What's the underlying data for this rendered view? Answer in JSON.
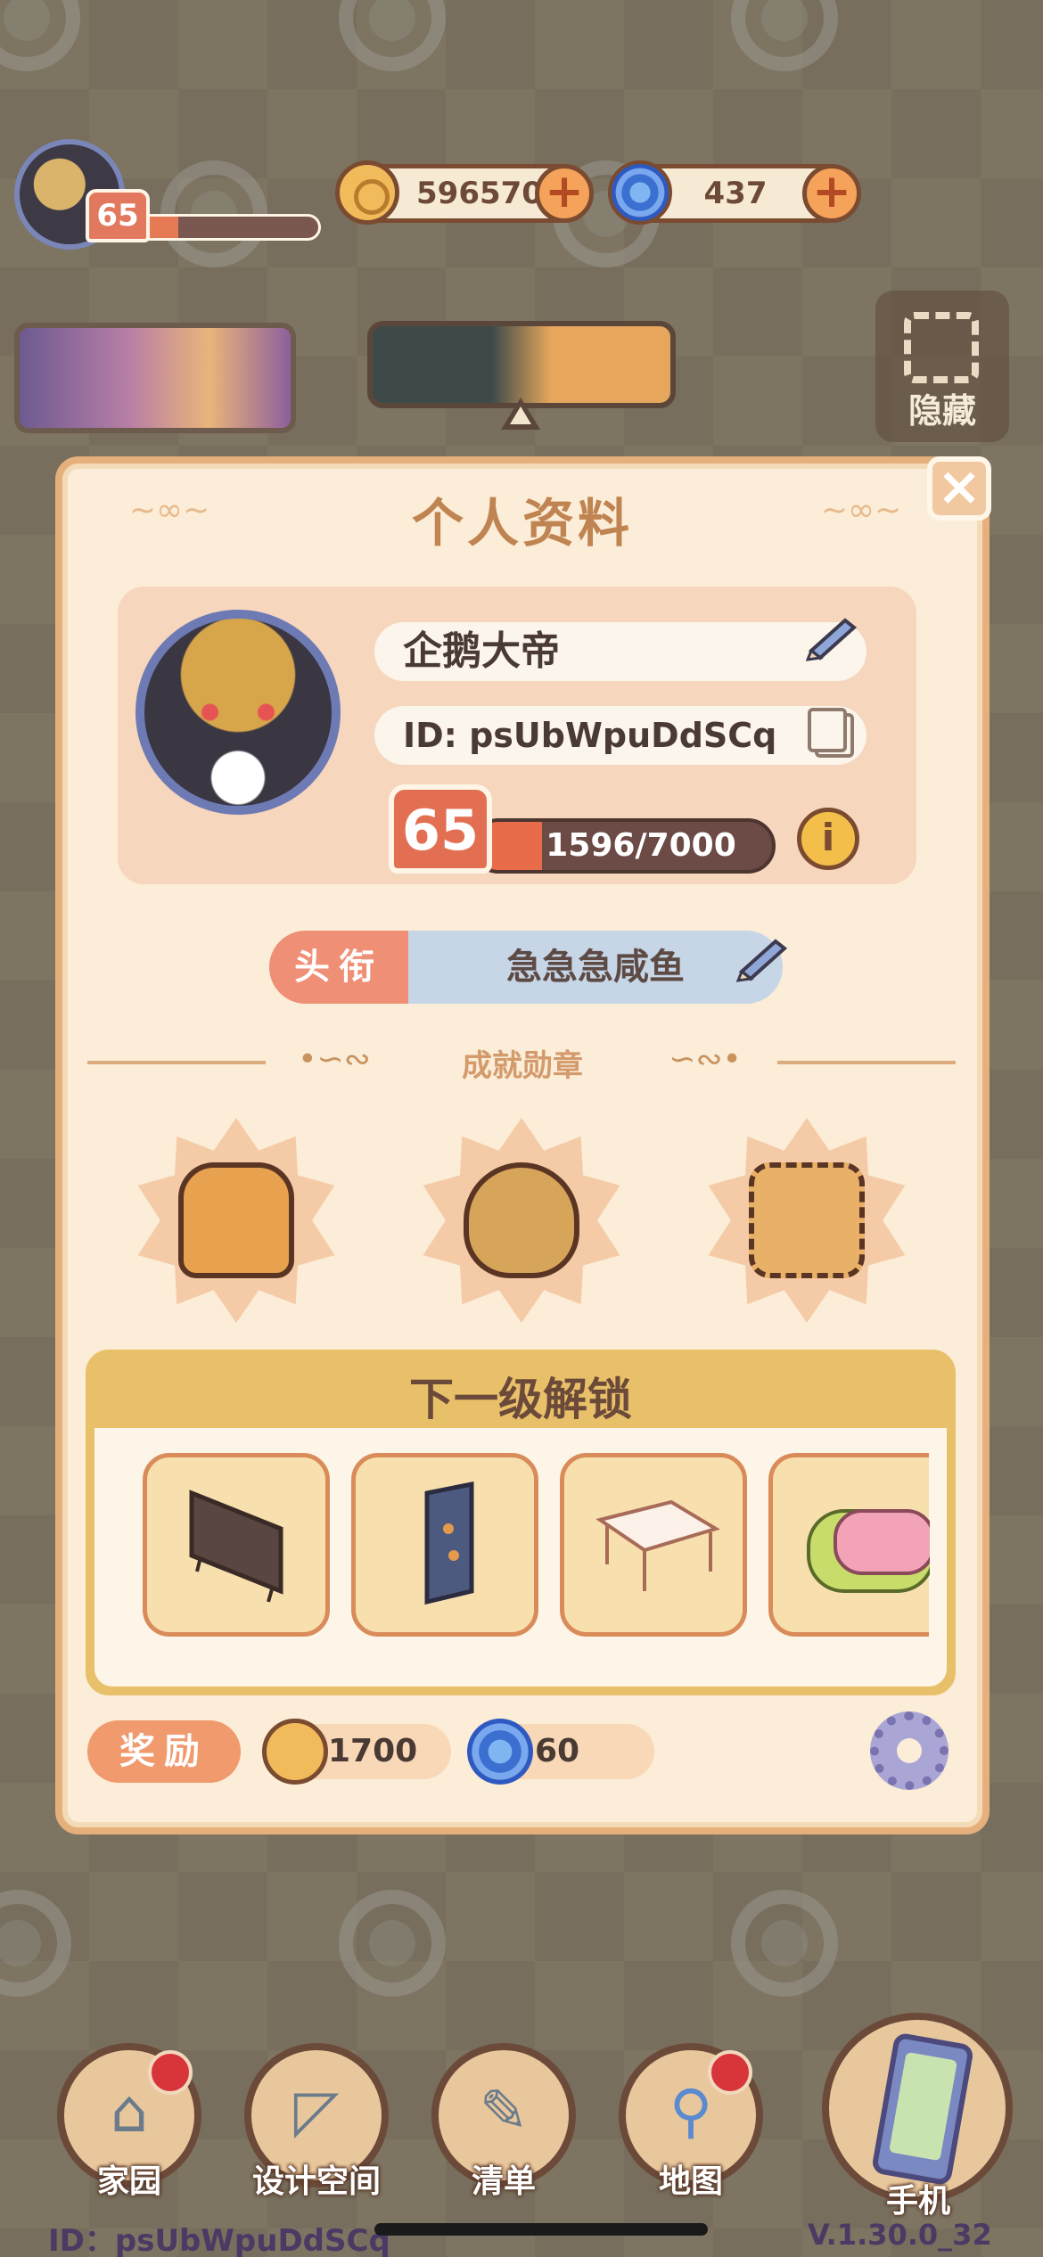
{
  "hud": {
    "player_level": "65",
    "player_xp_fraction": 0.23,
    "coins": "596570",
    "gems": "437",
    "hide_label": "隐藏"
  },
  "profile_panel": {
    "title": "个人资料",
    "name": "企鹅大帝",
    "id": "ID: psUbWpuDdSCq",
    "level": "65",
    "xp_text": "1596/7000",
    "xp_fraction": 0.228,
    "info_symbol": "i",
    "title_tag": "头衔",
    "title_value": "急急急咸鱼",
    "achievements_label": "成就勋章",
    "achievements": [
      {
        "icon": "dress-medal-icon",
        "color": "#e8a14e"
      },
      {
        "icon": "money-bag-medal-icon",
        "color": "#d7a55a"
      },
      {
        "icon": "stamp-medal-icon",
        "color": "#e9b068"
      }
    ],
    "next_unlock_label": "下一级解锁",
    "unlock_items": [
      {
        "icon": "tv-icon"
      },
      {
        "icon": "poster-icon"
      },
      {
        "icon": "table-icon"
      },
      {
        "icon": "bread-box-icon"
      }
    ],
    "reward_label": "奖励",
    "reward_coins": "1700",
    "reward_gems": "60"
  },
  "nav": {
    "items": [
      {
        "label": "家园",
        "icon": "house-icon",
        "badge": true
      },
      {
        "label": "设计空间",
        "icon": "design-tools-icon",
        "badge": false
      },
      {
        "label": "清单",
        "icon": "checklist-icon",
        "badge": false
      },
      {
        "label": "地图",
        "icon": "map-pin-icon",
        "badge": true
      },
      {
        "label": "手机",
        "icon": "phone-icon",
        "badge": false
      }
    ]
  },
  "footer": {
    "id": "ID：psUbWpuDdSCq",
    "version": "V.1.30.0_32"
  }
}
